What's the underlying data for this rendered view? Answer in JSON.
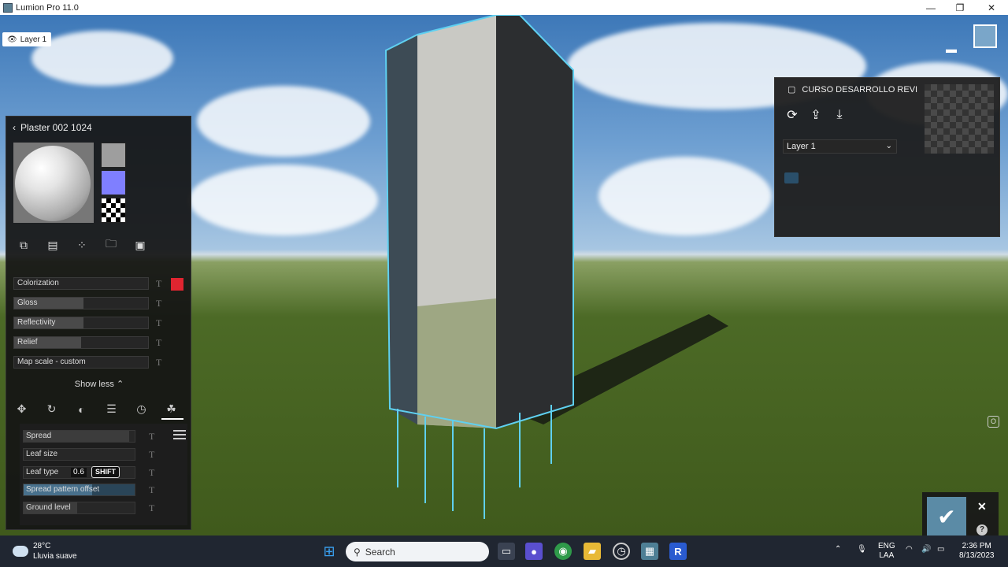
{
  "window": {
    "title": "Lumion Pro 11.0",
    "minimize": "—",
    "maximize": "❐",
    "close": "✕"
  },
  "viewport": {
    "layer_chip": "Layer 1"
  },
  "material": {
    "name": "Plaster 002 1024",
    "swatches": {
      "gray": "#9e9e9e",
      "purple": "#7f7fff"
    },
    "tools": [
      "copy-icon",
      "paste-icon",
      "scatter-icon",
      "folder-icon",
      "save-icon"
    ],
    "properties": [
      {
        "label": "Colorization",
        "fill": 0.0,
        "t": "T"
      },
      {
        "label": "Gloss",
        "fill": 0.52,
        "t": "T"
      },
      {
        "label": "Reflectivity",
        "fill": 0.52,
        "t": "T"
      },
      {
        "label": "Relief",
        "fill": 0.5,
        "t": "T"
      },
      {
        "label": "Map scale - custom",
        "fill": 0.0,
        "t": "T"
      }
    ],
    "colorization_color": "#e02530",
    "show_less": "Show less ⌃",
    "tabs": [
      "move-icon",
      "rotate-icon",
      "contrast-icon",
      "sliders-icon",
      "clock-icon",
      "foliage-icon"
    ],
    "foliage": {
      "spread": {
        "label": "Spread",
        "fill": 0.95,
        "t": "T"
      },
      "leaf_size": {
        "label": "Leaf size",
        "fill": 0.0,
        "t": "T"
      },
      "leaf_type": {
        "label": "Leaf type",
        "value": "0.6",
        "key": "SHIFT",
        "t": "T"
      },
      "spread_pattern_offset": {
        "label": "Spread pattern offset",
        "fill": 0.62,
        "t": "T"
      },
      "ground_level": {
        "label": "Ground level",
        "fill": 0.48,
        "t": "T"
      }
    }
  },
  "layers_panel": {
    "title": "CURSO DESARROLLO REVI",
    "selected_layer": "Layer 1"
  },
  "taskbar": {
    "weather_temp": "28°C",
    "weather_desc": "Lluvia suave",
    "search_placeholder": "Search",
    "lang_top": "ENG",
    "lang_bottom": "LAA",
    "time": "2:36 PM",
    "date": "8/13/2023"
  }
}
